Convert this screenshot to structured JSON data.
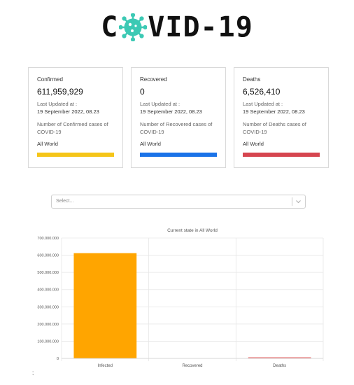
{
  "header": {
    "logo_left": "C",
    "logo_right": "VID-19"
  },
  "cards": [
    {
      "title": "Confirmed",
      "value": "611,959,929",
      "updated_label": "Last Updated at :",
      "updated_date": "19 September 2022, 08.23",
      "description": "Number of Confirmed cases of COVID-19",
      "region": "All World",
      "color": "#f5c518"
    },
    {
      "title": "Recovered",
      "value": "0",
      "updated_label": "Last Updated at :",
      "updated_date": "19 September 2022, 08.23",
      "description": "Number of Recovered cases of COVID-19",
      "region": "All World",
      "color": "#1a73e8"
    },
    {
      "title": "Deaths",
      "value": "6,526,410",
      "updated_label": "Last Updated at :",
      "updated_date": "19 September 2022, 08.23",
      "description": "Number of Deaths cases of COVID-19",
      "region": "All World",
      "color": "#d6454f"
    }
  ],
  "select": {
    "placeholder": "Select..."
  },
  "footnote": ";",
  "chart_data": {
    "type": "bar",
    "title": "Current state in All World",
    "categories": [
      "Infected",
      "Recovered",
      "Deaths"
    ],
    "values": [
      611959929,
      0,
      6526410
    ],
    "bar_colors": [
      "#ffa500",
      "#1a73e8",
      "#e87a7a"
    ],
    "ylim": [
      0,
      700000000
    ],
    "yticks": [
      0,
      100000000,
      200000000,
      300000000,
      400000000,
      500000000,
      600000000,
      700000000
    ],
    "ytick_labels": [
      "0",
      "100.000.000",
      "200.000.000",
      "300.000.000",
      "400.000.000",
      "500.000.000",
      "600.000.000",
      "700.000.000"
    ],
    "grid": true,
    "xlabel": "",
    "ylabel": ""
  }
}
